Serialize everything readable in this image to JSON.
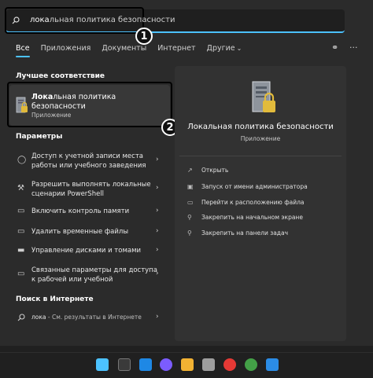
{
  "search": {
    "typed": "лока",
    "suggest": "льная политика безопасности"
  },
  "badges": [
    "1",
    "2"
  ],
  "tabs": [
    {
      "label": "Все",
      "active": true
    },
    {
      "label": "Приложения"
    },
    {
      "label": "Документы"
    },
    {
      "label": "Интернет"
    },
    {
      "label": "Другие"
    }
  ],
  "best_match": {
    "header": "Лучшее соответствие",
    "title_bold": "Лока",
    "title_rest": "льная политика безопасности",
    "subtitle": "Приложение"
  },
  "settings": {
    "header": "Параметры",
    "items": [
      {
        "icon": "user-icon",
        "text": "Доступ к учетной записи места работы или учебного заведения"
      },
      {
        "icon": "tools-icon",
        "text": "Разрешить выполнять локальные сценарии PowerShell"
      },
      {
        "icon": "memory-icon",
        "text": "Включить контроль памяти"
      },
      {
        "icon": "trash-icon",
        "text": "Удалить временные файлы"
      },
      {
        "icon": "disk-icon",
        "text": "Управление дисками и томами"
      },
      {
        "icon": "settings-icon",
        "text": "Связанные параметры для доступа к рабочей или учебной"
      }
    ]
  },
  "web": {
    "header": "Поиск в Интернете",
    "query": "лока",
    "suffix": " - См. результаты в Интернете"
  },
  "detail": {
    "title": "Локальная политика безопасности",
    "subtitle": "Приложение",
    "actions": [
      {
        "icon": "open-icon",
        "label": "Открыть"
      },
      {
        "icon": "admin-icon",
        "label": "Запуск от имени администратора"
      },
      {
        "icon": "folder-icon",
        "label": "Перейти к расположению файла"
      },
      {
        "icon": "pin-icon",
        "label": "Закрепить на начальном экране"
      },
      {
        "icon": "pin-taskbar-icon",
        "label": "Закрепить на панели задач"
      }
    ]
  },
  "taskbar": {
    "colors": [
      "#4cc2ff",
      "#3a3a3a",
      "#1e88e5",
      "#7b5cff",
      "#f2b233",
      "#9e9e9e",
      "#e53935",
      "#43a047",
      "#2b8ce6"
    ]
  }
}
